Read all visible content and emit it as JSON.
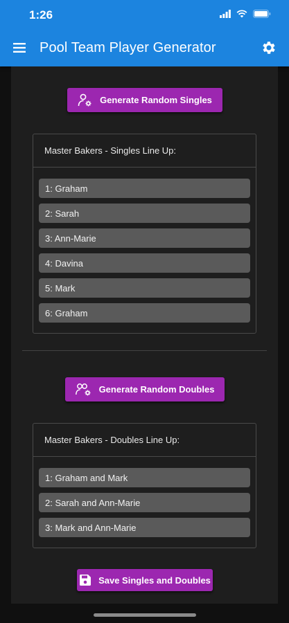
{
  "status_bar": {
    "time": "1:26"
  },
  "app_bar": {
    "title": "Pool Team Player Generator",
    "menu_icon": "hamburger-menu-icon",
    "settings_icon": "gear-icon",
    "color": "#1c84df"
  },
  "singles": {
    "button_label": "Generate Random Singles",
    "header": "Master Bakers - Singles Line Up:",
    "items": [
      {
        "text": "1: Graham"
      },
      {
        "text": "2: Sarah"
      },
      {
        "text": "3: Ann-Marie"
      },
      {
        "text": "4: Davina"
      },
      {
        "text": "5: Mark"
      },
      {
        "text": "6: Graham"
      }
    ]
  },
  "doubles": {
    "button_label": "Generate Random Doubles",
    "header": "Master Bakers - Doubles Line Up:",
    "items": [
      {
        "text": "1: Graham and Mark"
      },
      {
        "text": "2: Sarah and Ann-Marie"
      },
      {
        "text": "3: Mark and Ann-Marie"
      }
    ]
  },
  "save": {
    "button_label": "Save Singles and Doubles"
  },
  "colors": {
    "accent": "#9c27b0",
    "background": "#101010",
    "panel": "#1e1e1e",
    "list_item": "#5a5a5a"
  }
}
